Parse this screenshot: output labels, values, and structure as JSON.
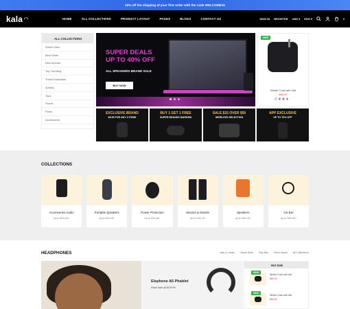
{
  "promo_bar": {
    "text": "15% off the shipping of your first order with the code WELCOME15"
  },
  "header": {
    "logo": "kala",
    "nav": [
      "HOME",
      "ALL COLLECTIONS",
      "PRODUCT LAYOUT",
      "PAGES",
      "BLOGS",
      "CONTACT US"
    ],
    "utility": {
      "signin": "SIGN IN",
      "register": "REGISTER",
      "currency": "USD",
      "language": "ENG",
      "cart_count": "0"
    }
  },
  "sidebar": {
    "title": "ALL COLLECTIONS",
    "items": [
      "What's New",
      "Best Seller",
      "New Arrivals",
      "Top Trending",
      "Travel Essentials",
      "Activity",
      "Tops",
      "Shorts",
      "Pants",
      "Accessories"
    ]
  },
  "hero": {
    "title_line1": "SUPER DEALS",
    "title_line2": "UP TO 40% OFF",
    "subtitle": "ALL SPEAKERS BRAND SALE",
    "button": "BUY NOW"
  },
  "side_product": {
    "badge": "NEW",
    "name": "Winter Coat with Hat",
    "price": "$60.00",
    "swatches": [
      "#ffffff",
      "#c0392b",
      "#e67e22",
      "#9b59b6"
    ]
  },
  "banners": [
    {
      "title": "EXCLUSIVE BRAND",
      "subtitle": "$9.99 FOR ANY 3 ITEMS"
    },
    {
      "title": "BUY 1 GET 1 FREE",
      "subtitle": "SUPER BRANDS MARDEM"
    },
    {
      "title": "SALE $15 OVER $50",
      "subtitle": "WIRELESS SELECTION"
    },
    {
      "title": "APP EXCLUSIVE",
      "subtitle": "UP TO 70% OFF"
    }
  ],
  "collections": {
    "title": "COLLECTIONS",
    "items": [
      {
        "name": "Accessories Audio",
        "offer": "Up to 50% off"
      },
      {
        "name": "Portable Speakers",
        "offer": "Up to 30% off"
      },
      {
        "name": "Power Protection",
        "offer": "Up to 20% off"
      },
      {
        "name": "Mounts & Stands",
        "offer": "Up to 10% off"
      },
      {
        "name": "Speakers",
        "offer": "Up to 25% off"
      },
      {
        "name": "On-Ear",
        "offer": "Up to 25% off"
      }
    ]
  },
  "headphones": {
    "title": "HEADPHONES",
    "brands": [
      "Jack & Jones",
      "Calvin Klein",
      "Ray Ban",
      "River Island",
      "All Collections"
    ],
    "featured": {
      "name": "Elephone A5 Phablet",
      "sale": "Flash Sale @ $109.99"
    },
    "hot_sale": {
      "title": "Hot Sale",
      "badge": "NEW",
      "items": [
        {
          "name": "Winter Coat with Hat",
          "price": "$60.00"
        },
        {
          "name": "Winter Coat with Hat",
          "price": "$60.00"
        }
      ]
    }
  }
}
